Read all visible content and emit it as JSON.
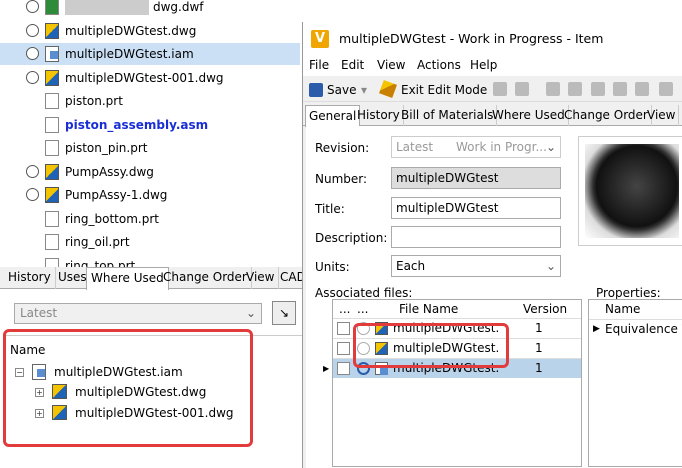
{
  "left_files": [
    {
      "name": "dwg.dwf",
      "type": "dwf",
      "radio": true,
      "obscured": true
    },
    {
      "name": "multipleDWGtest.dwg",
      "type": "dwg",
      "radio": true
    },
    {
      "name": "multipleDWGtest.iam",
      "type": "iam",
      "radio": true,
      "selected": true
    },
    {
      "name": "multipleDWGtest-001.dwg",
      "type": "dwg",
      "radio": true
    },
    {
      "name": "piston.prt",
      "type": "prt",
      "radio": false
    },
    {
      "name": "piston_assembly.asm",
      "type": "prt",
      "radio": false,
      "highlight": true
    },
    {
      "name": "piston_pin.prt",
      "type": "prt",
      "radio": false
    },
    {
      "name": "PumpAssy.dwg",
      "type": "dwg",
      "radio": true
    },
    {
      "name": "PumpAssy-1.dwg",
      "type": "dwg",
      "radio": true
    },
    {
      "name": "ring_bottom.prt",
      "type": "prt",
      "radio": false
    },
    {
      "name": "ring_oil.prt",
      "type": "prt",
      "radio": false
    },
    {
      "name": "ring_top.prt",
      "type": "prt",
      "radio": false
    }
  ],
  "left_tabs": [
    "History",
    "Uses",
    "Where Used",
    "Change Order",
    "View",
    "CAD"
  ],
  "left_active_tab": "Where Used",
  "left_select": "Latest",
  "tree": {
    "header": "Name",
    "root": "multipleDWGtest.iam",
    "children": [
      "multipleDWGtest.dwg",
      "multipleDWGtest-001.dwg"
    ]
  },
  "window": {
    "title": "multipleDWGtest - Work in Progress - Item",
    "logo": "V",
    "menu": [
      "File",
      "Edit",
      "View",
      "Actions",
      "Help"
    ],
    "toolbar": {
      "save": "Save",
      "exit_edit": "Exit Edit Mode"
    },
    "tabs": [
      "General",
      "History",
      "Bill of Materials",
      "Where Used",
      "Change Order",
      "View"
    ],
    "active_tab": "General"
  },
  "general": {
    "revision_label": "Revision:",
    "revision_value": "Latest",
    "revision_state": "Work in Progr...",
    "number_label": "Number:",
    "number_value": "multipleDWGtest",
    "title_label": "Title:",
    "title_value": "multipleDWGtest",
    "description_label": "Description:",
    "description_value": "",
    "units_label": "Units:",
    "units_value": "Each",
    "assoc_label": "Associated files:",
    "props_label": "Properties:"
  },
  "assoc_grid": {
    "headers": [
      "...",
      "...",
      "File Name",
      "Version"
    ],
    "rows": [
      {
        "name": "multipleDWGtest....",
        "version": "1"
      },
      {
        "name": "multipleDWGtest....",
        "version": "1"
      },
      {
        "name": "multipleDWGtest....",
        "version": "1",
        "selected": true
      }
    ]
  },
  "props_grid": {
    "header": "Name",
    "rows": [
      "Equivalence V"
    ]
  }
}
